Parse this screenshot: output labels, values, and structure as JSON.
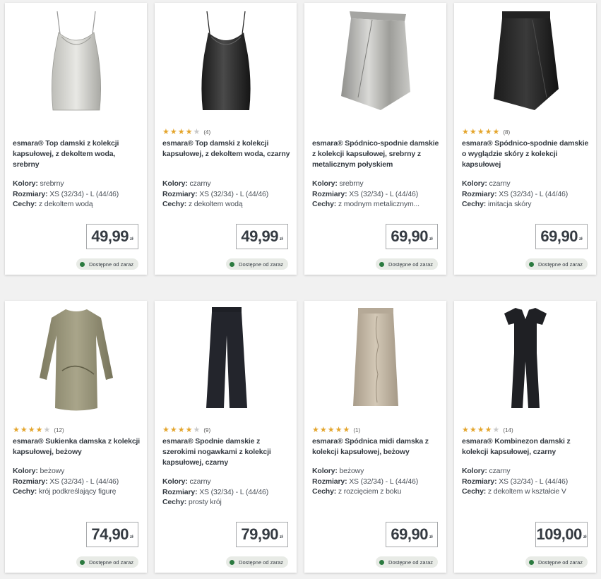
{
  "colors": {
    "star": "#e4a52c",
    "available_dot": "#2b7a3f"
  },
  "products": [
    {
      "title": "esmara® Top damski z kolekcji kapsułowej, z dekoltem woda, srebrny",
      "rating": null,
      "reviews": "",
      "kolory": "srebrny",
      "rozmiary": "XS (32/34) - L (44/46)",
      "cechy": "z dekoltem wodą",
      "price": "49,99",
      "currency": "zł",
      "availability": "Dostępne od zaraz",
      "image": "silver-top"
    },
    {
      "title": "esmara® Top damski z kolekcji kapsułowej, z dekoltem woda, czarny",
      "rating": 4,
      "reviews": "(4)",
      "kolory": "czarny",
      "rozmiary": "XS (32/34) - L (44/46)",
      "cechy": "z dekoltem wodą",
      "price": "49,99",
      "currency": "zł",
      "availability": "Dostępne od zaraz",
      "image": "black-top"
    },
    {
      "title": "esmara® Spódnico-spodnie damskie z kolekcji kapsułowej, srebrny z metalicznym połyskiem",
      "rating": null,
      "reviews": "",
      "kolory": "srebrny",
      "rozmiary": "XS (32/34) - L (44/46)",
      "cechy": "z modnym metalicznym...",
      "price": "69,90",
      "currency": "zł",
      "availability": "Dostępne od zaraz",
      "image": "silver-skort"
    },
    {
      "title": "esmara® Spódnico-spodnie damskie o wyglądzie skóry z kolekcji kapsułowej",
      "rating": 4.5,
      "reviews": "(8)",
      "kolory": "czarny",
      "rozmiary": "XS (32/34) - L (44/46)",
      "cechy": "imitacja skóry",
      "price": "69,90",
      "currency": "zł",
      "availability": "Dostępne od zaraz",
      "image": "black-skort"
    },
    {
      "title": "esmara® Sukienka damska z kolekcji kapsułowej, beżowy",
      "rating": 4,
      "reviews": "(12)",
      "kolory": "beżowy",
      "rozmiary": "XS (32/34) - L (44/46)",
      "cechy": "krój podkreślający figurę",
      "price": "74,90",
      "currency": "zł",
      "availability": "Dostępne od zaraz",
      "image": "beige-dress"
    },
    {
      "title": "esmara® Spodnie damskie z szerokimi nogawkami z kolekcji kapsułowej, czarny",
      "rating": 4,
      "reviews": "(9)",
      "kolory": "czarny",
      "rozmiary": "XS (32/34) - L (44/46)",
      "cechy": "prosty krój",
      "price": "79,90",
      "currency": "zł",
      "availability": "Dostępne od zaraz",
      "image": "black-trousers"
    },
    {
      "title": "esmara® Spódnica midi damska z kolekcji kapsułowej, beżowy",
      "rating": 5,
      "reviews": "(1)",
      "kolory": "beżowy",
      "rozmiary": "XS (32/34) - L (44/46)",
      "cechy": "z rozcięciem z boku",
      "price": "69,90",
      "currency": "zł",
      "availability": "Dostępne od zaraz",
      "image": "beige-skirt"
    },
    {
      "title": "esmara® Kombinezon damski z kolekcji kapsułowej, czarny",
      "rating": 4,
      "reviews": "(14)",
      "kolory": "czarny",
      "rozmiary": "XS (32/34) - L (44/46)",
      "cechy": "z dekoltem w kształcie V",
      "price": "109,00",
      "currency": "zł",
      "availability": "Dostępne od zaraz",
      "image": "black-jumpsuit"
    }
  ],
  "labels": {
    "kolory": "Kolory:",
    "rozmiary": "Rozmiary:",
    "cechy": "Cechy:"
  }
}
